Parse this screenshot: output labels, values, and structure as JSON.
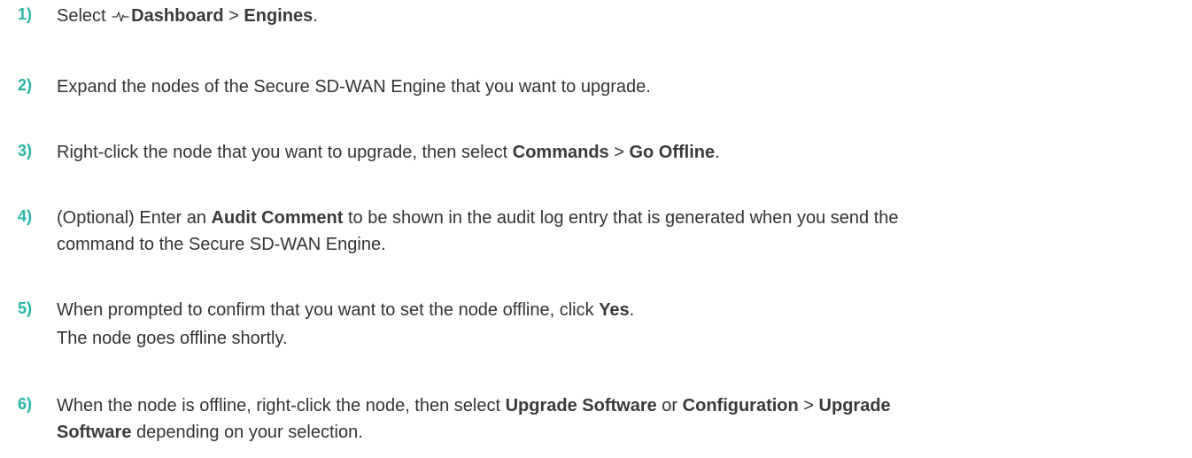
{
  "steps": [
    {
      "number": "1)",
      "lines": [
        [
          {
            "text": "Select ",
            "bold": false
          },
          {
            "icon": "pulse-icon"
          },
          {
            "text": "Dashboard",
            "bold": true
          },
          {
            "text": " > ",
            "bold": false
          },
          {
            "text": "Engines",
            "bold": true
          },
          {
            "text": ".",
            "bold": false
          }
        ]
      ]
    },
    {
      "number": "2)",
      "lines": [
        [
          {
            "text": "Expand the nodes of the Secure SD-WAN Engine that you want to upgrade.",
            "bold": false
          }
        ]
      ]
    },
    {
      "number": "3)",
      "lines": [
        [
          {
            "text": "Right-click the node that you want to upgrade, then select ",
            "bold": false
          },
          {
            "text": "Commands",
            "bold": true
          },
          {
            "text": " > ",
            "bold": false
          },
          {
            "text": "Go Offline",
            "bold": true
          },
          {
            "text": ".",
            "bold": false
          }
        ]
      ]
    },
    {
      "number": "4)",
      "lines": [
        [
          {
            "text": "(Optional) Enter an ",
            "bold": false
          },
          {
            "text": "Audit Comment",
            "bold": true
          },
          {
            "text": " to be shown in the audit log entry that is generated when you send the",
            "bold": false
          }
        ],
        [
          {
            "text": "command to the Secure SD-WAN Engine.",
            "bold": false
          }
        ]
      ]
    },
    {
      "number": "5)",
      "lines": [
        [
          {
            "text": "When prompted to confirm that you want to set the node offline, click ",
            "bold": false
          },
          {
            "text": "Yes",
            "bold": true
          },
          {
            "text": ".",
            "bold": false
          }
        ],
        [
          {
            "text": "The node goes offline shortly.",
            "bold": false
          }
        ]
      ]
    },
    {
      "number": "6)",
      "lines": [
        [
          {
            "text": "When the node is offline, right-click the node, then select ",
            "bold": false
          },
          {
            "text": "Upgrade Software",
            "bold": true
          },
          {
            "text": " or ",
            "bold": false
          },
          {
            "text": "Configuration",
            "bold": true
          },
          {
            "text": " > ",
            "bold": false
          },
          {
            "text": "Upgrade",
            "bold": true
          }
        ],
        [
          {
            "text": "Software",
            "bold": true
          },
          {
            "text": " depending on your selection.",
            "bold": false
          }
        ]
      ]
    }
  ],
  "colors": {
    "step_number": "#27b5a4",
    "text": "#333333"
  }
}
